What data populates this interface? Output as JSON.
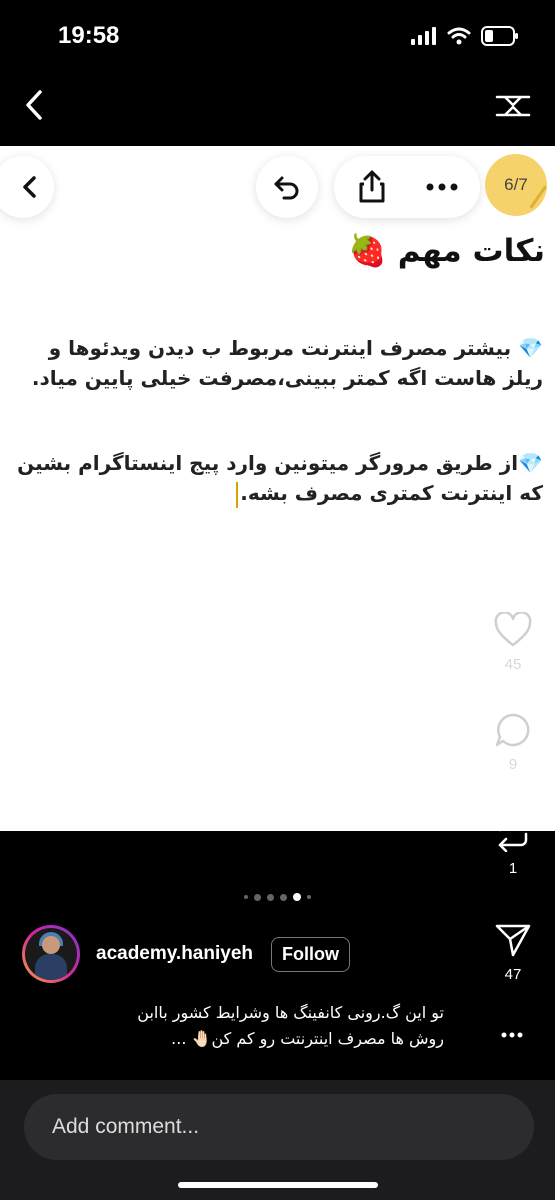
{
  "status_bar": {
    "time": "19:58"
  },
  "post": {
    "page_indicator": "6/7",
    "heading": "نکات مهم 🍓",
    "paragraph_1": "💎 بیشتر مصرف اینترنت مربوط ب دیدن ویدئوها و ریلز هاست اگه کمتر ببینی،مصرفت خیلی پایین میاد.",
    "paragraph_2": "💎از طریق مرورگر میتونین وارد پیج اینستاگرام بشین که اینترنت کمتری مصرف بشه."
  },
  "actions": {
    "likes": "45",
    "comments": "9",
    "reposts": "1",
    "shares": "47"
  },
  "carousel": {
    "total": 6,
    "active": 4
  },
  "author": {
    "username": "academy.haniyeh",
    "follow_label": "Follow"
  },
  "caption": {
    "line_1": "تو این گ.رونی کانفینگ ها وشرایط کشور باابن",
    "line_2": "روش ها مصرف اینترنتت رو کم کن🤚🏻 ..."
  },
  "comment": {
    "placeholder": "Add comment..."
  },
  "icons": [
    "back-icon",
    "adjust-icon",
    "undo-icon",
    "share-icon",
    "more-icon",
    "heart-icon",
    "comment-icon",
    "repost-icon",
    "send-icon",
    "signal-icon",
    "wifi-icon",
    "battery-icon"
  ]
}
